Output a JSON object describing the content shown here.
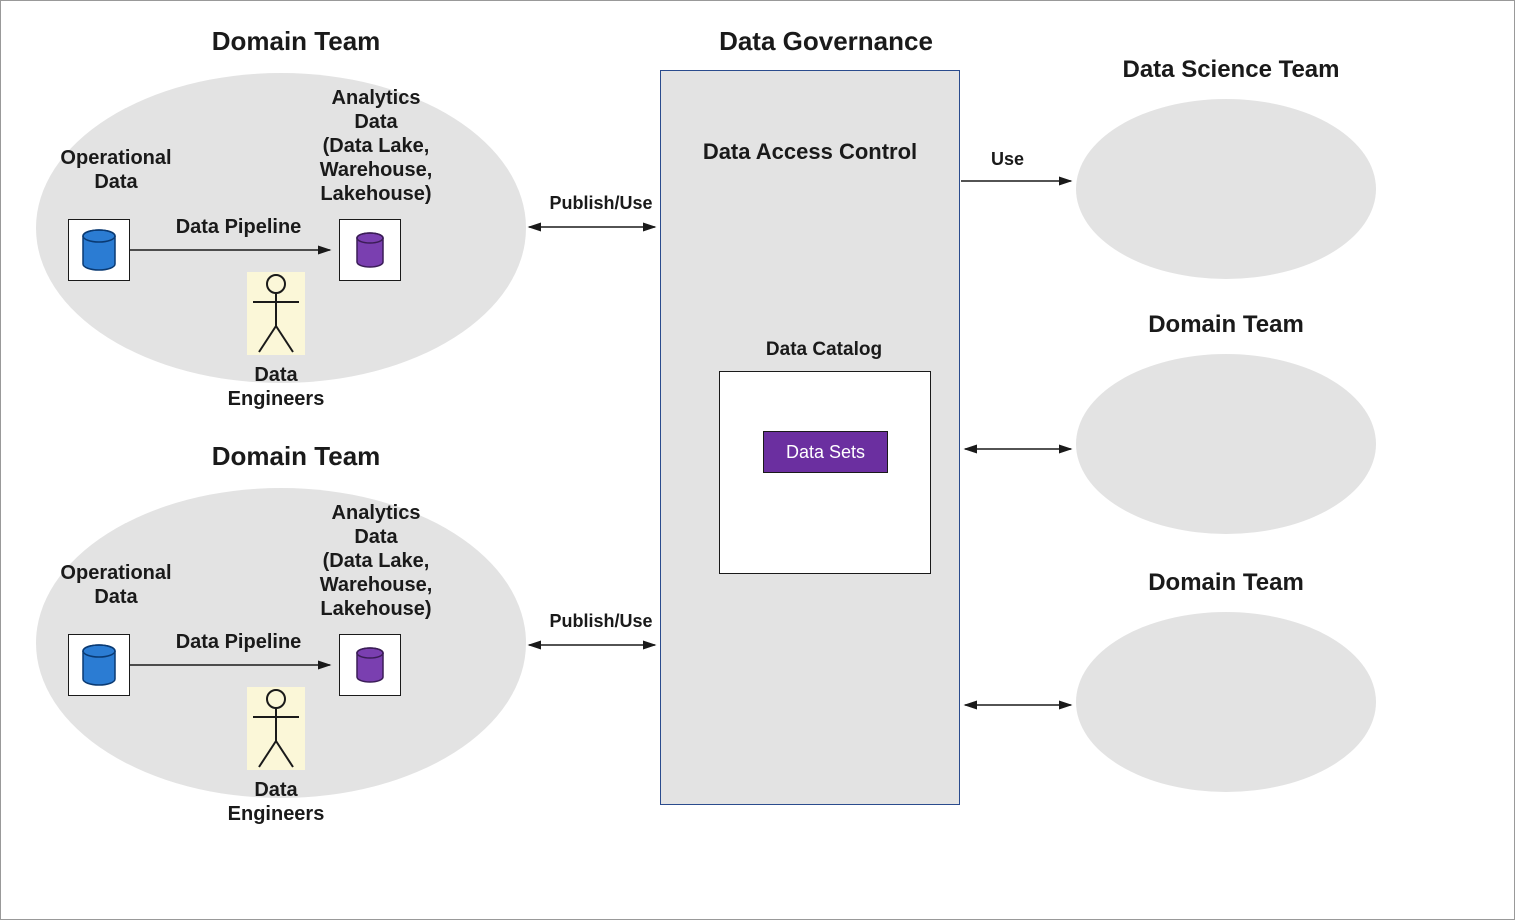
{
  "domainTeamTop": {
    "title": "Domain Team",
    "operationalLabel": "Operational",
    "operationalLabel2": "Data",
    "analyticsLine1": "Analytics",
    "analyticsLine2": "Data",
    "analyticsLine3": "(Data Lake,",
    "analyticsLine4": "Warehouse,",
    "analyticsLine5": "Lakehouse)",
    "pipelineLabel": "Data Pipeline",
    "engineersLine1": "Data",
    "engineersLine2": "Engineers"
  },
  "domainTeamBottom": {
    "title": "Domain Team",
    "operationalLabel": "Operational",
    "operationalLabel2": "Data",
    "analyticsLine1": "Analytics",
    "analyticsLine2": "Data",
    "analyticsLine3": "(Data Lake,",
    "analyticsLine4": "Warehouse,",
    "analyticsLine5": "Lakehouse)",
    "pipelineLabel": "Data Pipeline",
    "engineersLine1": "Data",
    "engineersLine2": "Engineers"
  },
  "governance": {
    "title": "Data Governance",
    "accessControl": "Data Access Control",
    "catalogTitle": "Data Catalog",
    "dataSetsLabel": "Data Sets"
  },
  "connectors": {
    "publishUse": "Publish/Use",
    "use": "Use"
  },
  "rightSide": {
    "dataScienceTeam": "Data Science Team",
    "domainTeam1": "Domain Team",
    "domainTeam2": "Domain Team"
  },
  "colors": {
    "dbBlue": "#2b7cd3",
    "dbPurple": "#7a3fb0",
    "strokeDark": "#1a1a1a",
    "govBorder": "#2a4b8d",
    "ellipseFill": "#e3e3e3"
  }
}
